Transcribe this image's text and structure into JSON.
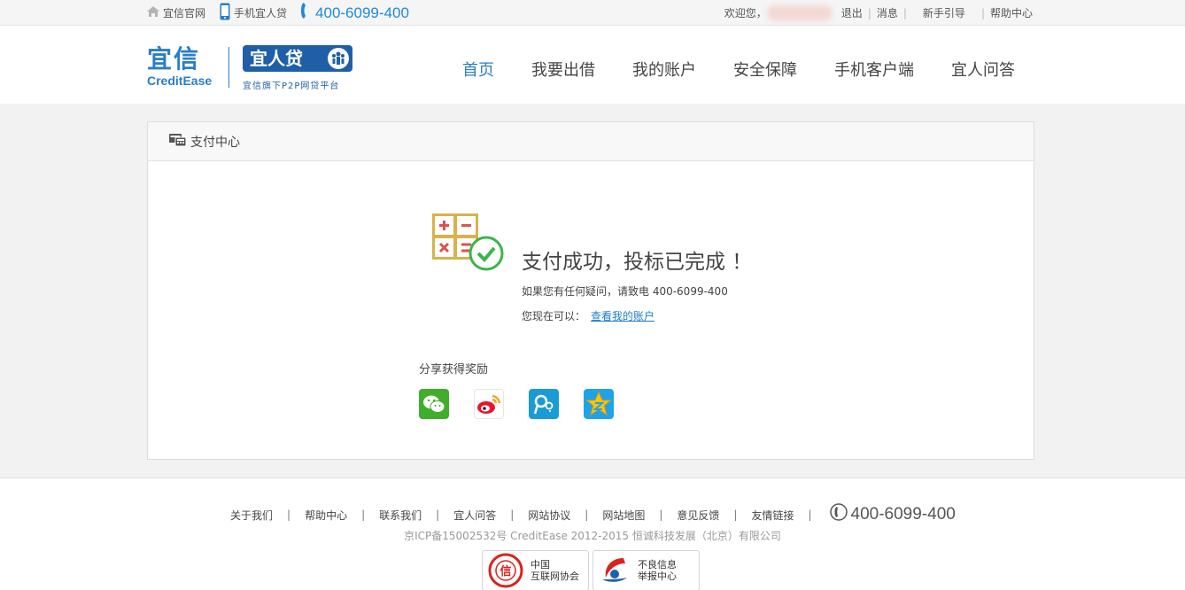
{
  "topbar": {
    "official_site": "宜信官网",
    "mobile_app": "手机宜人贷",
    "phone": "400-6099-400",
    "welcome": "欢迎您，",
    "logout": "退出",
    "messages": "消息",
    "sep": "|",
    "beginner_guide": "新手引导",
    "help_center": "帮助中心"
  },
  "header": {
    "logo_cn": "宜信",
    "logo_en": "CreditEase",
    "logo2_cn": "宜人贷",
    "logo2_sub": "宜信旗下P2P网贷平台",
    "nav": [
      {
        "label": "首页",
        "active": true
      },
      {
        "label": "我要出借",
        "active": false
      },
      {
        "label": "我的账户",
        "active": false
      },
      {
        "label": "安全保障",
        "active": false
      },
      {
        "label": "手机客户端",
        "active": false
      },
      {
        "label": "宜人问答",
        "active": false
      }
    ]
  },
  "panel": {
    "title": "支付中心",
    "success_title": "支付成功，投标已完成 ！",
    "contact_text": "如果您有任何疑问，请致电 400-6099-400",
    "now_you_can": "您现在可以：",
    "view_account_link": "查看我的账户",
    "share_label": "分享获得奖励",
    "share_icons": [
      "wechat-icon",
      "weibo-icon",
      "tencent-weibo-icon",
      "qzone-icon"
    ]
  },
  "footer": {
    "links": [
      "关于我们",
      "帮助中心",
      "联系我们",
      "宜人问答",
      "网站协议",
      "网站地图",
      "意见反馈",
      "友情链接"
    ],
    "sep": "|",
    "phone": "400-6099-400",
    "copyright": "京ICP备15002532号 CreditEase 2012-2015 恒诚科技发展（北京）有限公司",
    "badge1_line1": "中国",
    "badge1_line2": "互联网协会",
    "badge1_seal": "信",
    "badge2_line1": "不良信息",
    "badge2_line2": "举报中心"
  },
  "colors": {
    "accent": "#2a7dc8",
    "link": "#1e7ec8",
    "success_green": "#3bb54a"
  }
}
